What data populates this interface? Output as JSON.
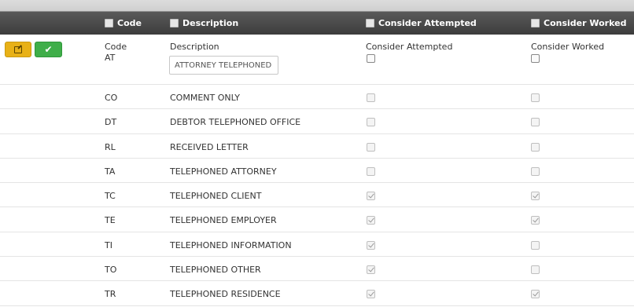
{
  "header": {
    "code": "Code",
    "description": "Description",
    "consider_attempted": "Consider Attempted",
    "consider_worked": "Consider Worked"
  },
  "edit_row": {
    "code_label": "Code",
    "code_value": "AT",
    "description_label": "Description",
    "description_value": "ATTORNEY TELEPHONED",
    "attempted_label": "Consider Attempted",
    "worked_label": "Consider Worked",
    "attempted_checked": false,
    "worked_checked": false
  },
  "rows": [
    {
      "code": "CO",
      "description": "COMMENT ONLY",
      "attempted": false,
      "worked": false
    },
    {
      "code": "DT",
      "description": "DEBTOR TELEPHONED OFFICE",
      "attempted": false,
      "worked": false
    },
    {
      "code": "RL",
      "description": "RECEIVED LETTER",
      "attempted": false,
      "worked": false
    },
    {
      "code": "TA",
      "description": "TELEPHONED ATTORNEY",
      "attempted": false,
      "worked": false
    },
    {
      "code": "TC",
      "description": "TELEPHONED CLIENT",
      "attempted": true,
      "worked": true
    },
    {
      "code": "TE",
      "description": "TELEPHONED EMPLOYER",
      "attempted": true,
      "worked": true
    },
    {
      "code": "TI",
      "description": "TELEPHONED INFORMATION",
      "attempted": true,
      "worked": false
    },
    {
      "code": "TO",
      "description": "TELEPHONED OTHER",
      "attempted": true,
      "worked": false
    },
    {
      "code": "TR",
      "description": "TELEPHONED RESIDENCE",
      "attempted": true,
      "worked": true
    }
  ]
}
